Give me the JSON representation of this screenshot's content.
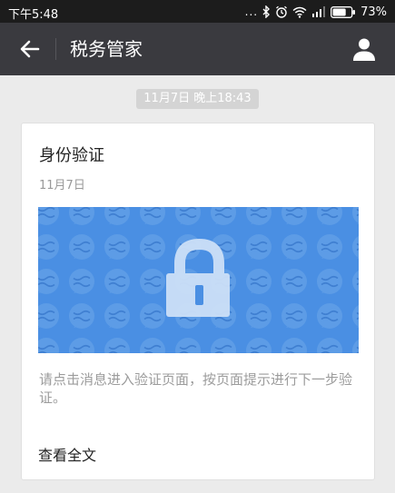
{
  "status_bar": {
    "time": "下午5:48",
    "dots": "...",
    "battery_percent": "73%",
    "battery_level": 0.73,
    "icons": [
      "bluetooth-icon",
      "alarm-icon",
      "wifi-icon",
      "signal-icon",
      "battery-icon"
    ]
  },
  "title_bar": {
    "title": "税务管家",
    "back_icon": "arrow-left-icon",
    "profile_icon": "person-icon"
  },
  "message": {
    "timestamp": "11月7日 晚上18:43",
    "card": {
      "title": "身份验证",
      "date": "11月7日",
      "cover_icon": "lock-icon",
      "description": "请点击消息进入验证页面，按页面提示进行下一步验证。",
      "read_full": "查看全文"
    }
  },
  "colors": {
    "status_bar_bg": "#1c1c1c",
    "title_bar_bg": "#3a3a3f",
    "page_bg": "#ebebeb",
    "cover_blue": "#4a8fe3"
  }
}
